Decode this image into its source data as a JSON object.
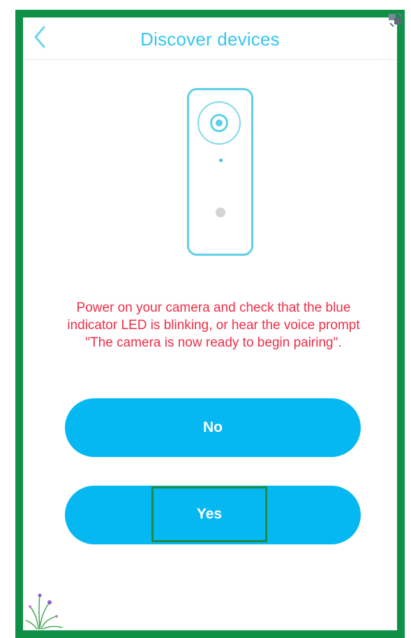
{
  "header": {
    "title": "Discover devices",
    "back_icon": "chevron-left-icon",
    "accent_color": "#35c6ee"
  },
  "illustration": {
    "icon": "camera-device-icon",
    "stroke_color": "#5fd0e8"
  },
  "instruction": {
    "text": "Power on your camera and check that the blue indicator LED is blinking, or hear the voice prompt \"The camera is now ready to begin pairing\".",
    "color": "#ee2e47"
  },
  "buttons": {
    "no_label": "No",
    "yes_label": "Yes",
    "background_color": "#06b8f1",
    "text_color": "#ffffff"
  },
  "annotation": {
    "frame_color": "#0e9146",
    "highlight_color": "#1e8a44"
  }
}
